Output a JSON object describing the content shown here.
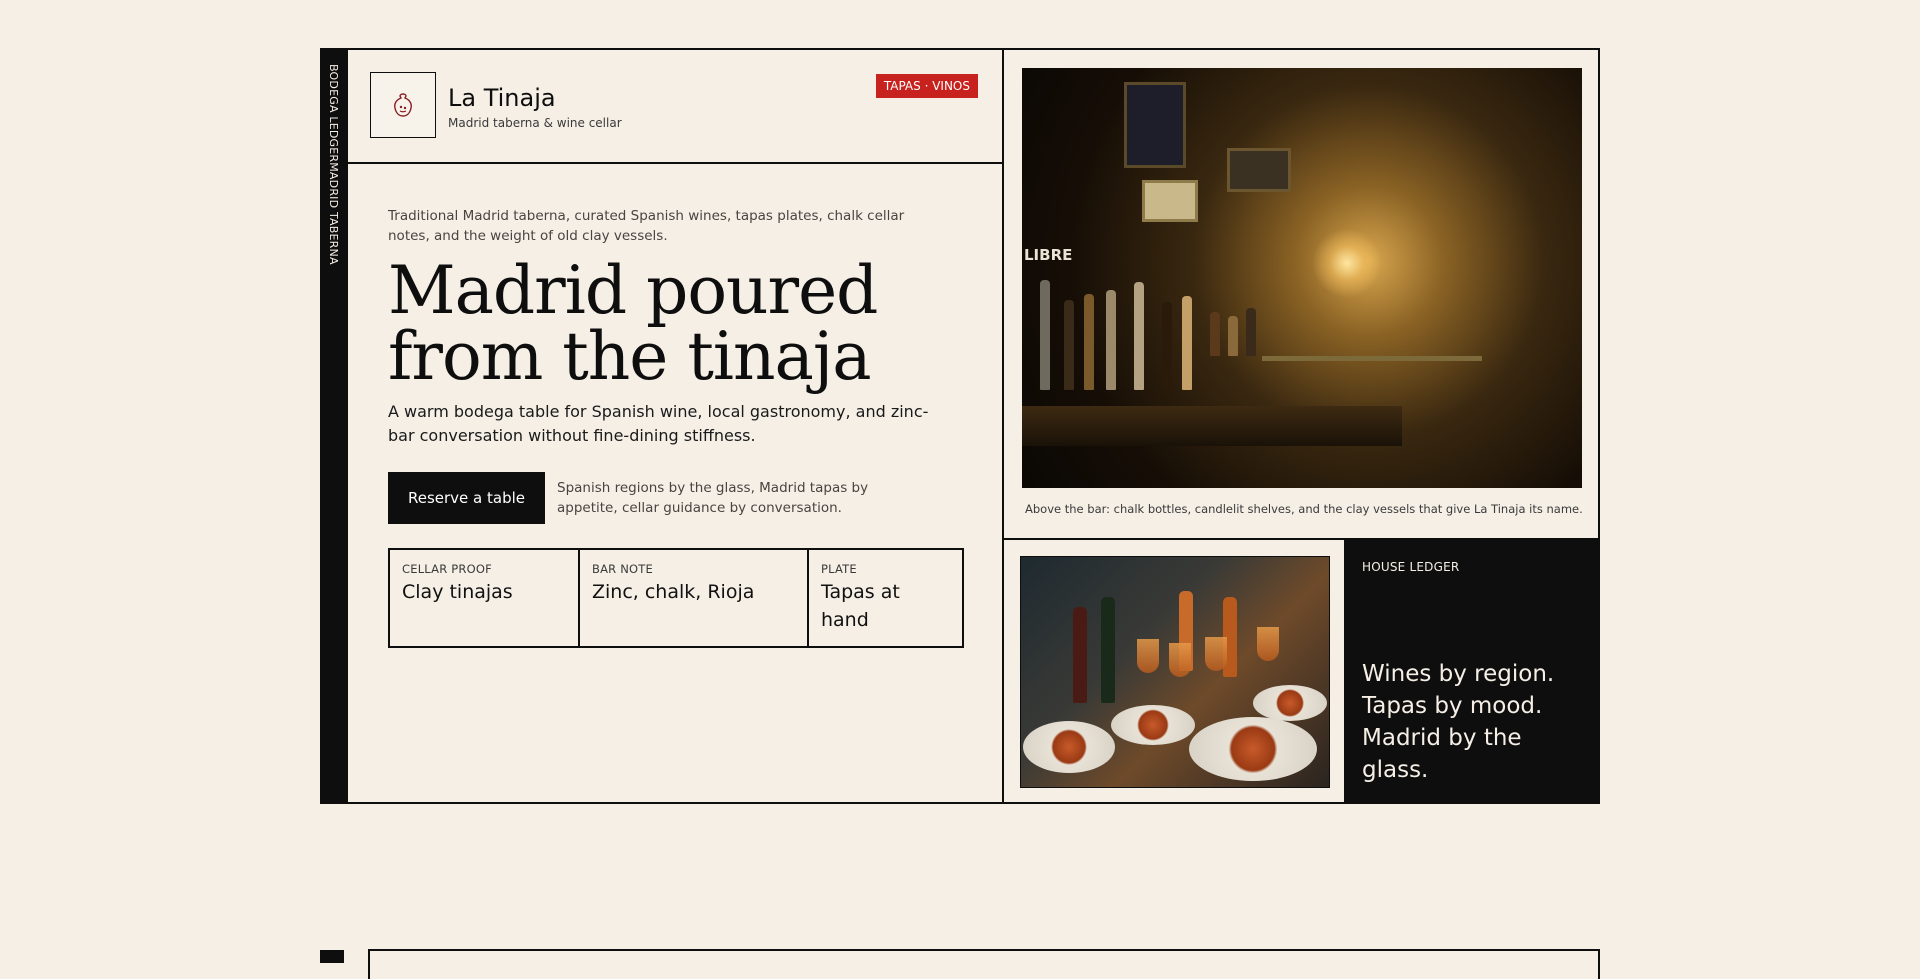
{
  "spine": {
    "label": "BODEGA LEDGERMADRID TABERNA"
  },
  "brand": {
    "name": "La Tinaja",
    "subtitle": "Madrid taberna & wine cellar",
    "tag": "TAPAS · VINOS",
    "logo_icon": "clay-jar-icon"
  },
  "hero": {
    "intro": "Traditional Madrid taberna, curated Spanish wines, tapas plates, chalk cellar notes, and the weight of old clay vessels.",
    "headline": "Madrid poured from the tinaja",
    "lede": "A warm bodega table for Spanish wine, local gastronomy, and zinc-bar conversation without fine-dining stiffness.",
    "cta_label": "Reserve a table",
    "cta_note": "Spanish regions by the glass, Madrid tapas by appetite, cellar guidance by conversation."
  },
  "facts": [
    {
      "label": "CELLAR PROOF",
      "value": "Clay tinajas"
    },
    {
      "label": "BAR NOTE",
      "value": "Zinc, chalk, Rioja"
    },
    {
      "label": "PLATE",
      "value": "Tapas at hand"
    }
  ],
  "photo": {
    "caption": "Above the bar: chalk bottles, candlelit shelves, and the clay vessels that give La Tinaja its name.",
    "sign_text": "LIBRE"
  },
  "ledger": {
    "label": "HOUSE LEDGER",
    "text": "Wines by region. Tapas by mood. Madrid by the glass."
  },
  "colors": {
    "background": "#f5efe6",
    "ink": "#0e0e0e",
    "accent_red": "#c8221f"
  }
}
